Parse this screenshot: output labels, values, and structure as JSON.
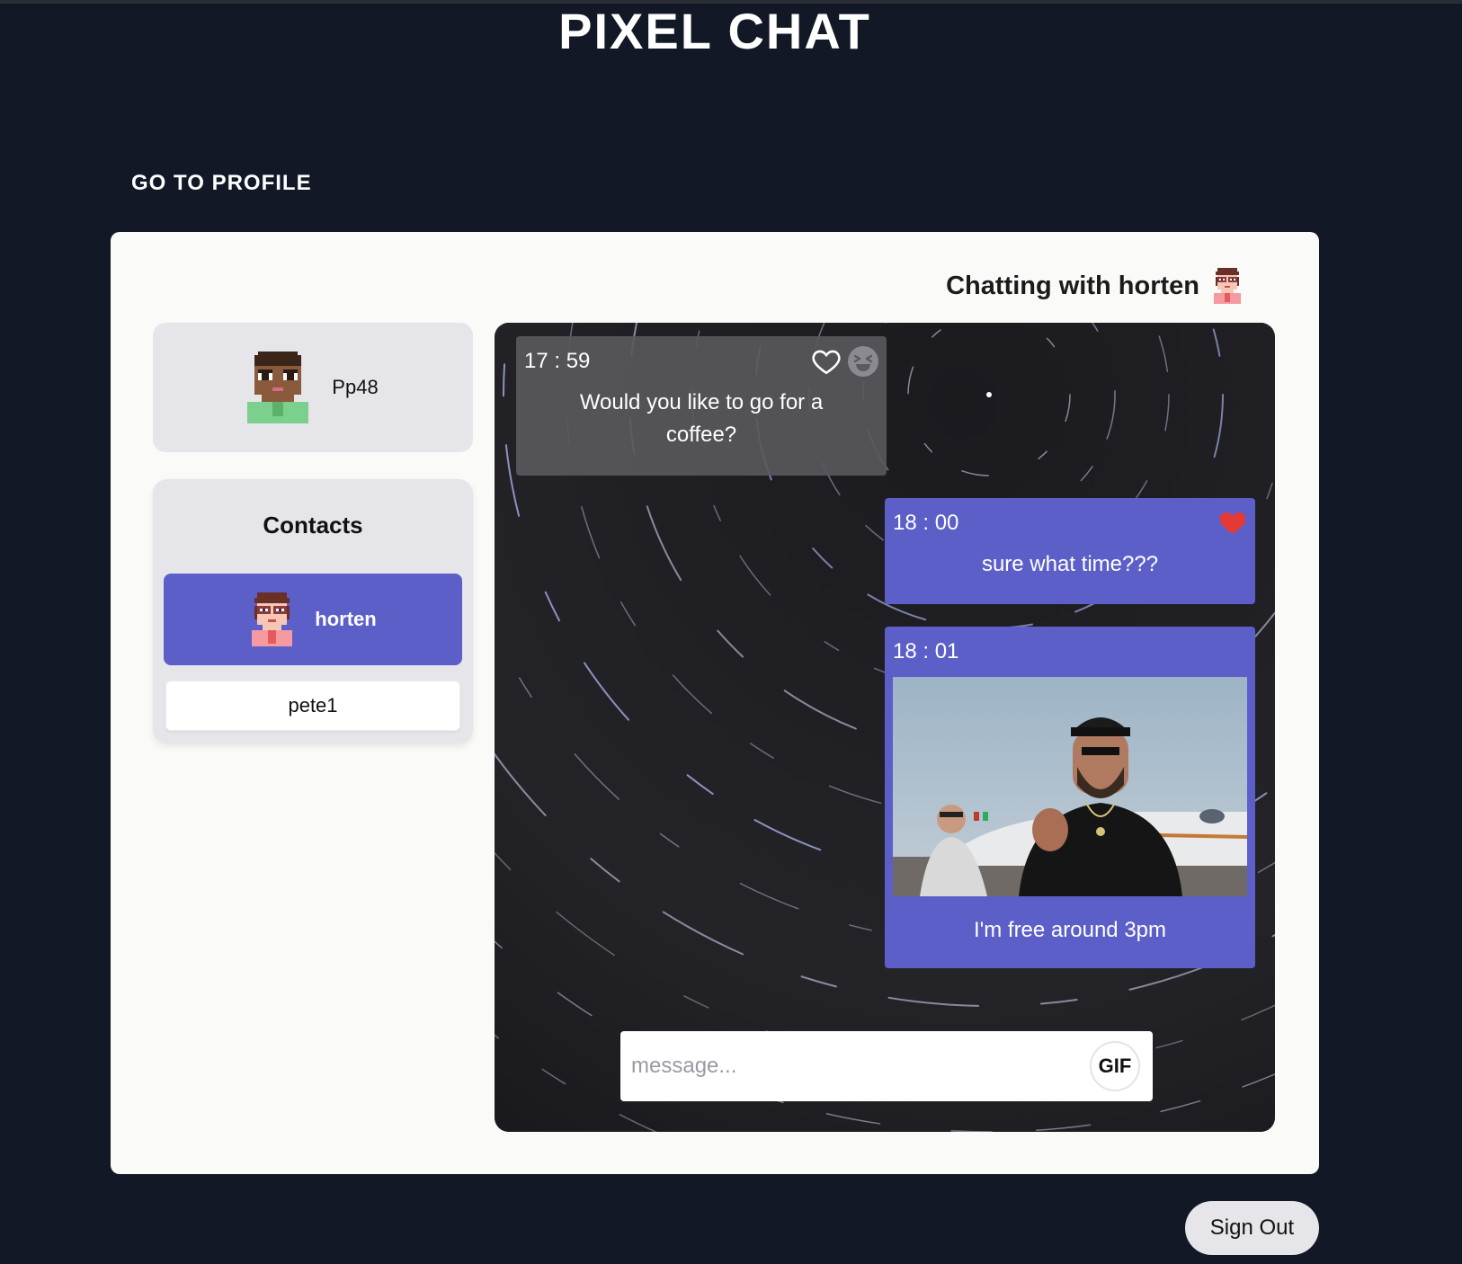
{
  "app": {
    "title": "PIXEL CHAT"
  },
  "nav": {
    "profile_link": "GO TO PROFILE"
  },
  "chat": {
    "heading": "Chatting with horten"
  },
  "current_user": {
    "name": "Pp48"
  },
  "contacts": {
    "title": "Contacts",
    "items": [
      {
        "name": "horten",
        "active": true
      },
      {
        "name": "pete1",
        "active": false
      }
    ]
  },
  "messages": [
    {
      "time": "17 : 59",
      "text": "Would you like to go for a coffee?",
      "direction": "received",
      "liked": false
    },
    {
      "time": "18 : 00",
      "text": "sure what time???",
      "direction": "sent",
      "liked": true
    },
    {
      "time": "18 : 01",
      "text": "I'm free around 3pm",
      "direction": "sent",
      "has_gif": true
    }
  ],
  "composer": {
    "placeholder": "message...",
    "gif_label": "GIF"
  },
  "signout": {
    "label": "Sign Out"
  },
  "colors": {
    "background": "#131827",
    "panel": "#fafaf8",
    "accent": "#5c5fc8",
    "card": "#e6e6ea",
    "heart": "#e53935"
  },
  "icons": {
    "user_avatar": "pixel-avatar-pp48",
    "contact_avatar": "pixel-avatar-horten",
    "like": "heart-icon",
    "react": "laughing-emoji-icon"
  }
}
